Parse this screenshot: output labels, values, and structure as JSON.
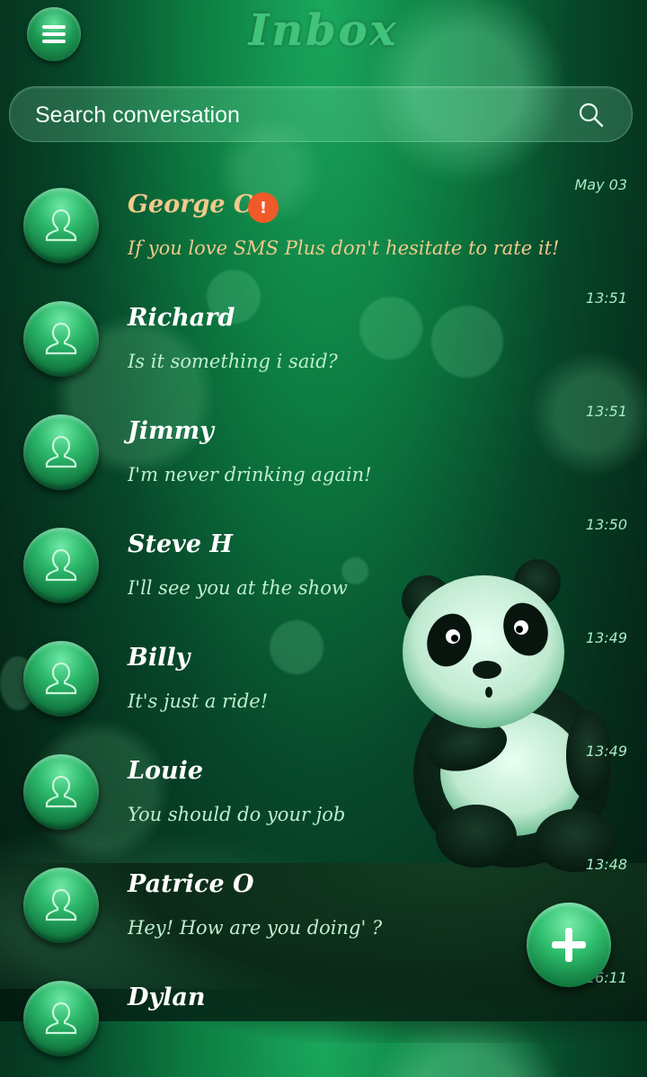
{
  "header": {
    "title": "Inbox",
    "menu_icon": "hamburger-menu-icon"
  },
  "search": {
    "placeholder": "Search conversation",
    "icon": "search-icon"
  },
  "conversations": [
    {
      "name": "George C",
      "preview": "If you love SMS Plus don't hesitate to rate it!",
      "time": "May 03",
      "alert": "!",
      "highlight": true
    },
    {
      "name": "Richard",
      "preview": "Is it something i said?",
      "time": "13:51"
    },
    {
      "name": "Jimmy",
      "preview": "I'm never drinking again!",
      "time": "13:51"
    },
    {
      "name": "Steve H",
      "preview": "I'll see you at the show",
      "time": "13:50"
    },
    {
      "name": "Billy",
      "preview": "It's just a ride!",
      "time": "13:49"
    },
    {
      "name": "Louie",
      "preview": "You should do your job",
      "time": "13:49"
    },
    {
      "name": "Patrice O",
      "preview": "Hey! How are you doing' ?",
      "time": "13:48"
    },
    {
      "name": "Dylan",
      "preview": "",
      "time": "16:11"
    }
  ],
  "fab": {
    "icon": "plus-icon"
  },
  "colors": {
    "accent": "#2fbe6e",
    "highlight_text": "#f3c98c",
    "alert_badge": "#f05a28",
    "preview_text": "#bfeed0"
  }
}
